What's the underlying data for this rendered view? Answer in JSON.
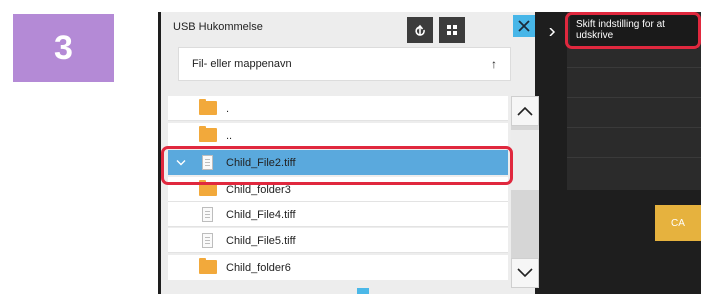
{
  "step": {
    "number": "3"
  },
  "dialog": {
    "title": "USB Hukommelse",
    "search_placeholder": "Fil- eller mappenavn",
    "sort_arrow": "↑",
    "refresh_icon": "refresh-icon",
    "grid_icon": "grid-view-icon",
    "close_icon": "close-icon"
  },
  "file_list": [
    {
      "label": ".",
      "type": "folder",
      "selected": false
    },
    {
      "label": "..",
      "type": "folder",
      "selected": false
    },
    {
      "label": "Child_File2.tiff",
      "type": "file",
      "selected": true
    },
    {
      "label": "Child_folder3",
      "type": "folder",
      "selected": false
    },
    {
      "label": "Child_File4.tiff",
      "type": "file",
      "selected": false
    },
    {
      "label": "Child_File5.tiff",
      "type": "file",
      "selected": false
    },
    {
      "label": "Child_folder6",
      "type": "folder",
      "selected": false
    }
  ],
  "right_panel": {
    "change_settings_label": "Skift indstilling for at udskrive",
    "ca_label": "CA"
  },
  "colors": {
    "step_badge": "#b48ad6",
    "selected_row": "#5aa9dd",
    "highlight": "#e0283e",
    "close_button": "#47b6e8",
    "ca_button": "#e6b23e",
    "folder": "#f2a93b"
  }
}
